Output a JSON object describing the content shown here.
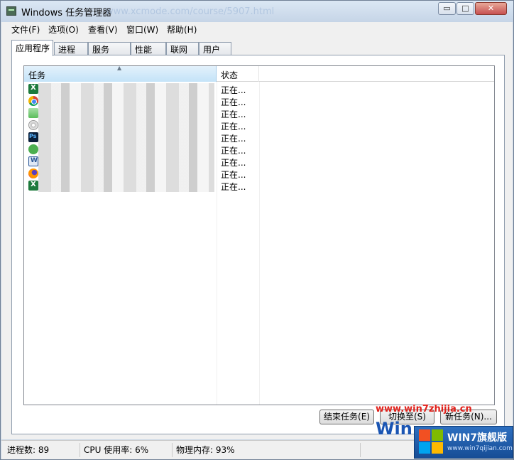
{
  "window": {
    "title": "Windows 任务管理器",
    "title_overlay": "www.xcmode.com/course/5907.html"
  },
  "caption_buttons": {
    "minimize": "▭",
    "maximize": "□",
    "close": "✕"
  },
  "menu": [
    "文件(F)",
    "选项(O)",
    "查看(V)",
    "窗口(W)",
    "帮助(H)"
  ],
  "tabs": [
    "应用程序",
    "进程",
    "服务",
    "性能",
    "联网",
    "用户"
  ],
  "active_tab": "应用程序",
  "list": {
    "columns": {
      "task": "任务",
      "status": "状态"
    },
    "rows": [
      {
        "icon": "excel-icon",
        "status": "正在..."
      },
      {
        "icon": "chrome-icon",
        "status": "正在..."
      },
      {
        "icon": "folder-icon",
        "status": "正在..."
      },
      {
        "icon": "cd-icon",
        "status": "正在..."
      },
      {
        "icon": "photoshop-icon",
        "status": "正在..."
      },
      {
        "icon": "wechat-icon",
        "status": "正在..."
      },
      {
        "icon": "word-icon",
        "status": "正在..."
      },
      {
        "icon": "firefox-icon",
        "status": "正在..."
      },
      {
        "icon": "excel-icon",
        "status": "正在..."
      }
    ]
  },
  "buttons": {
    "end_task": "结束任务(E)",
    "switch_to": "切换至(S)",
    "new_task": "新任务(N)..."
  },
  "statusbar": {
    "processes": "进程数: 89",
    "cpu": "CPU 使用率: 6%",
    "memory": "物理内存: 93%"
  },
  "watermark": {
    "url": "www.win7zhijia.cn",
    "win": "Win",
    "badge_title": "WIN7旗舰版",
    "badge_url": "www.win7qijian.com"
  }
}
